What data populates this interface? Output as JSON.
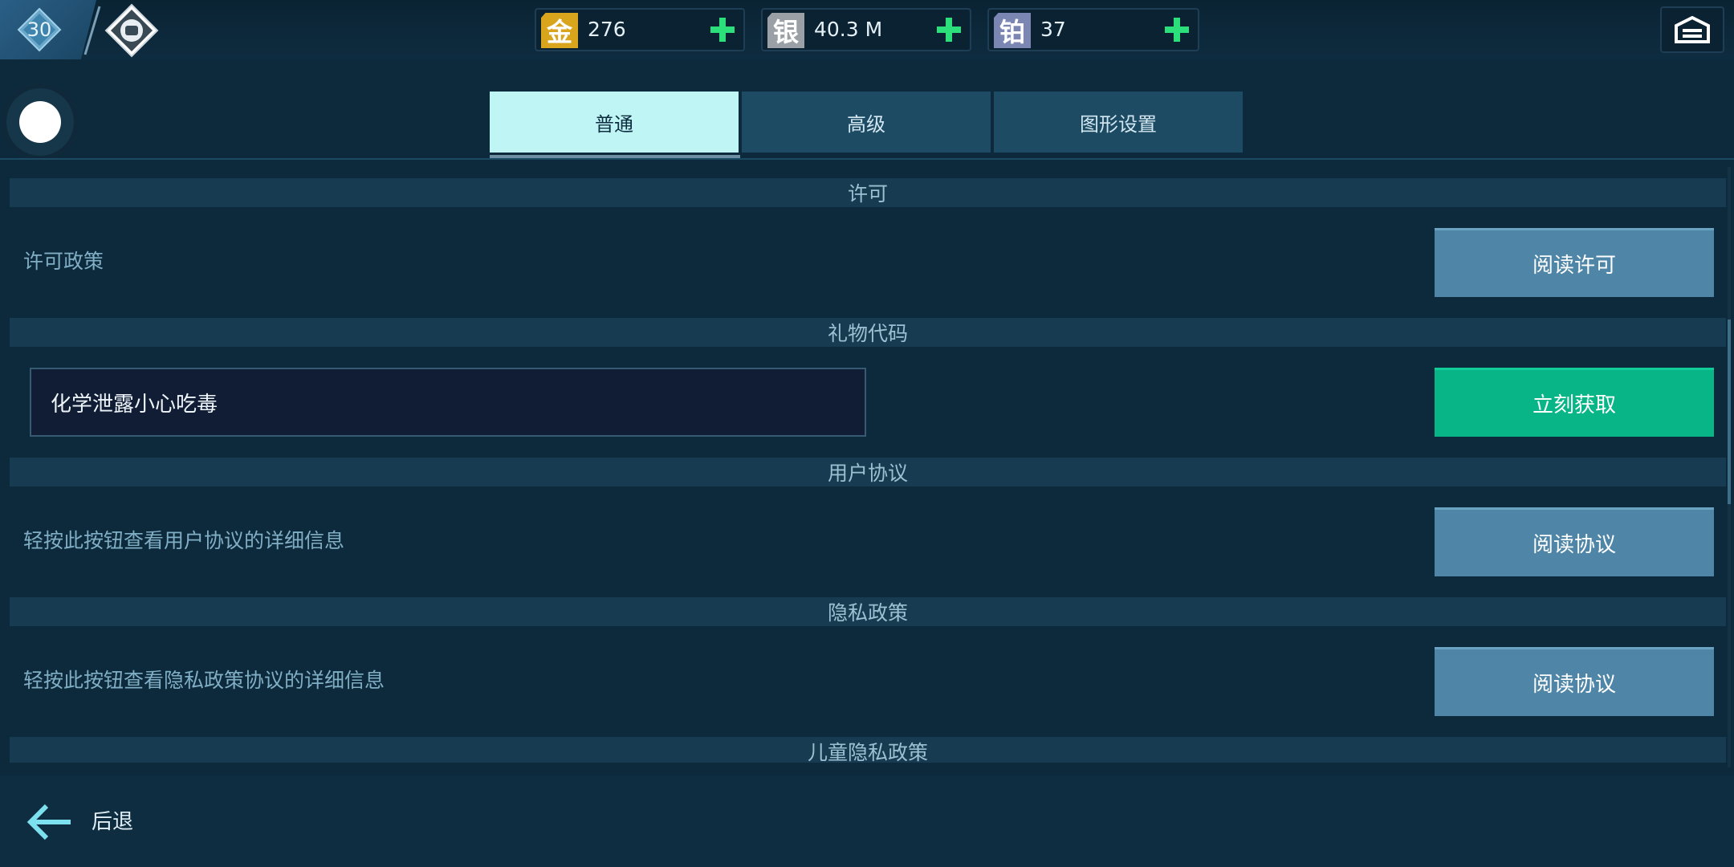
{
  "header": {
    "level": "30",
    "currencies": [
      {
        "name": "gold",
        "glyph": "金",
        "value": "276",
        "color": "#d9a51c"
      },
      {
        "name": "silver",
        "glyph": "银",
        "value": "40.3 M",
        "color": "#9aa0a6"
      },
      {
        "name": "platinum",
        "glyph": "铂",
        "value": "37",
        "color": "#7c86b3"
      }
    ]
  },
  "tabs": [
    {
      "label": "普通",
      "active": true
    },
    {
      "label": "高级",
      "active": false
    },
    {
      "label": "图形设置",
      "active": false
    }
  ],
  "sections": {
    "license": {
      "header": "许可",
      "label": "许可政策",
      "button": "阅读许可"
    },
    "gift_code": {
      "header": "礼物代码",
      "input_value": "化学泄露小心吃毒",
      "button": "立刻获取"
    },
    "user_agreement": {
      "header": "用户协议",
      "label": "轻按此按钮查看用户协议的详细信息",
      "button": "阅读协议"
    },
    "privacy": {
      "header": "隐私政策",
      "label": "轻按此按钮查看隐私政策协议的详细信息",
      "button": "阅读协议"
    },
    "children_privacy": {
      "header": "儿童隐私政策"
    }
  },
  "footer": {
    "back_label": "后退"
  },
  "colors": {
    "accent_green": "#07b586",
    "button_blue": "#4f86a8",
    "active_tab": "#bff5f5",
    "plus_green": "#2be07a"
  }
}
